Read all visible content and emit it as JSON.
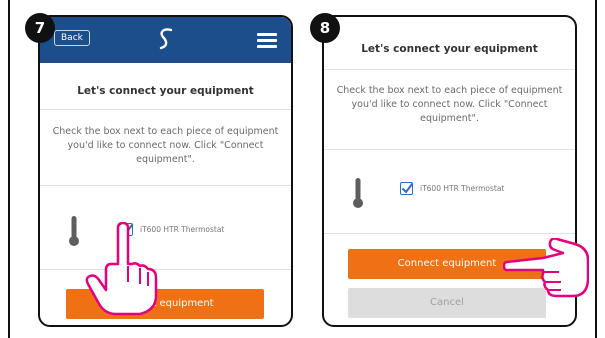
{
  "steps": [
    {
      "number": "7",
      "back_label": "Back",
      "title": "Let's connect your equipment",
      "instruction_line1": "Check the box next to each piece of equipment",
      "instruction_line2": "you'd like to connect now. Click \"Connect",
      "instruction_line3": "equipment\".",
      "device_label": "iT600 HTR Thermostat",
      "device_checked": true,
      "connect_label": "nect equipment"
    },
    {
      "number": "8",
      "title": "Let's connect your equipment",
      "instruction_line1": "Check the box next to each piece of equipment",
      "instruction_line2": "you'd like to connect now. Click \"Connect",
      "instruction_line3": "equipment\".",
      "device_label": "iT600 HTR Thermostat",
      "device_checked": true,
      "connect_label": "Connect equipment",
      "cancel_label": "Cancel"
    }
  ],
  "icons": {
    "logo": "app-logo-icon",
    "menu": "hamburger-menu-icon",
    "device": "thermometer-icon",
    "pointer": "pointing-hand-icon"
  },
  "colors": {
    "appbar": "#1c4e8c",
    "accent": "#f07113",
    "hand": "#e5007e",
    "checkbox": "#2b6cc6"
  }
}
